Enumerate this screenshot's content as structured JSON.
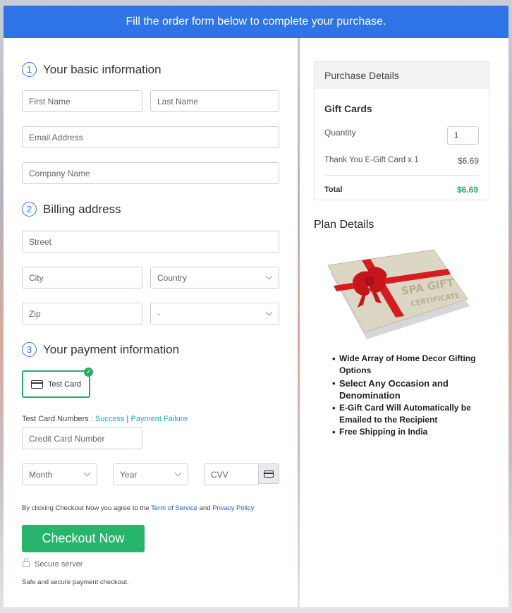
{
  "banner": {
    "text": "Fill the order form below to complete your purchase."
  },
  "sections": {
    "basic": {
      "num": "1",
      "title": "Your basic information"
    },
    "billing": {
      "num": "2",
      "title": "Billing address"
    },
    "payment": {
      "num": "3",
      "title": "Your payment information"
    }
  },
  "basic_fields": {
    "first_name": "First Name",
    "last_name": "Last Name",
    "email": "Email Address",
    "company": "Company Name"
  },
  "billing_fields": {
    "street": "Street",
    "city": "City",
    "country": "Country",
    "zip": "Zip",
    "state": "-"
  },
  "payment": {
    "test_card_label": "Test Card",
    "test_numbers_label": "Test Card Numbers : ",
    "success_link": "Success",
    "separator": " | ",
    "failure_link": "Payment Failure",
    "card_number": "Credit Card Number",
    "month": "Month",
    "year": "Year",
    "cvv": "CVV"
  },
  "agreement": {
    "prefix": "By clicking Checkout Now you agree to the ",
    "terms": "Term of Service",
    "and": " and ",
    "privacy": "Privacy Policy"
  },
  "checkout_button": "Checkout Now",
  "secure": {
    "server": "Secure server",
    "note": "Safe and secure payment checkout."
  },
  "purchase_details": {
    "header": "Purchase Details",
    "product": "Gift Cards",
    "quantity_label": "Quantity",
    "quantity_value": "1",
    "line_item": "Thank You E-Gift Card x 1",
    "line_price": "$6.69",
    "total_label": "Total",
    "total_price": "$6.69"
  },
  "plan_details": {
    "title": "Plan Details",
    "card_image_lettering": "SPA GIFT CERTIFICATE",
    "benefits": [
      "Wide Array of Home Decor Gifting Options",
      "Select Any Occasion and Denomination",
      "E-Gift Card Will Automatically be Emailed to the Recipient",
      "Free Shipping in India"
    ]
  },
  "colors": {
    "banner": "#2f74e6",
    "checkout_button": "#27b56c",
    "total_price": "#27ae6a",
    "link": "#1aa9c4"
  }
}
